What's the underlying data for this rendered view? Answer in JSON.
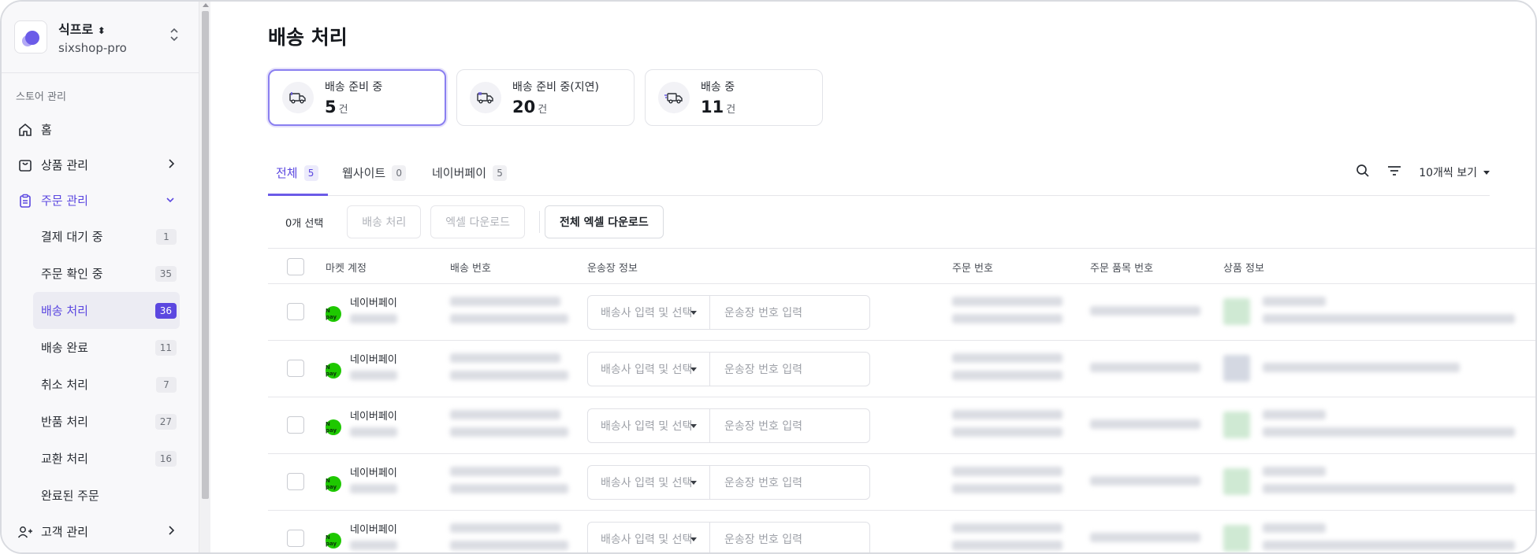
{
  "store": {
    "name": "식프로",
    "name_arrow": "⬍",
    "id": "sixshop-pro"
  },
  "sidebar": {
    "section_title": "스토어 관리",
    "home": "홈",
    "product": "상품 관리",
    "order": "주문 관리",
    "customer": "고객 관리",
    "subitems": [
      {
        "label": "결제 대기 중",
        "count": "1"
      },
      {
        "label": "주문 확인 중",
        "count": "35"
      },
      {
        "label": "배송 처리",
        "count": "36"
      },
      {
        "label": "배송 완료",
        "count": "11"
      },
      {
        "label": "취소 처리",
        "count": "7"
      },
      {
        "label": "반품 처리",
        "count": "27"
      },
      {
        "label": "교환 처리",
        "count": "16"
      },
      {
        "label": "완료된 주문",
        "count": ""
      }
    ]
  },
  "page": {
    "title": "배송 처리"
  },
  "cards": [
    {
      "label": "배송 준비 중",
      "value": "5",
      "unit": "건"
    },
    {
      "label": "배송 준비 중(지연)",
      "value": "20",
      "unit": "건"
    },
    {
      "label": "배송 중",
      "value": "11",
      "unit": "건"
    }
  ],
  "tabs": [
    {
      "label": "전체",
      "count": "5"
    },
    {
      "label": "웹사이트",
      "count": "0"
    },
    {
      "label": "네이버페이",
      "count": "5"
    }
  ],
  "toolbar": {
    "page_size": "10개씩 보기"
  },
  "actions": {
    "selected": "0개 선택",
    "process": "배송 처리",
    "excel": "엑셀 다운로드",
    "excel_all": "전체 엑셀 다운로드"
  },
  "table": {
    "headers": {
      "market": "마켓 계정",
      "ship_no": "배송 번호",
      "waybill": "운송장 정보",
      "order_no": "주문 번호",
      "item_no": "주문 품목 번호",
      "product": "상품 정보"
    },
    "courier_placeholder": "배송사 입력 및 선택",
    "tracking_placeholder": "운송장 번호 입력",
    "rows": [
      {
        "market": "네이버페이",
        "market_icon": "N pay"
      },
      {
        "market": "네이버페이",
        "market_icon": "N pay"
      },
      {
        "market": "네이버페이",
        "market_icon": "N pay"
      },
      {
        "market": "네이버페이",
        "market_icon": "N pay"
      },
      {
        "market": "네이버페이",
        "market_icon": "N pay"
      }
    ]
  },
  "colors": {
    "accent": "#5b47e0",
    "naver": "#1ec800"
  }
}
